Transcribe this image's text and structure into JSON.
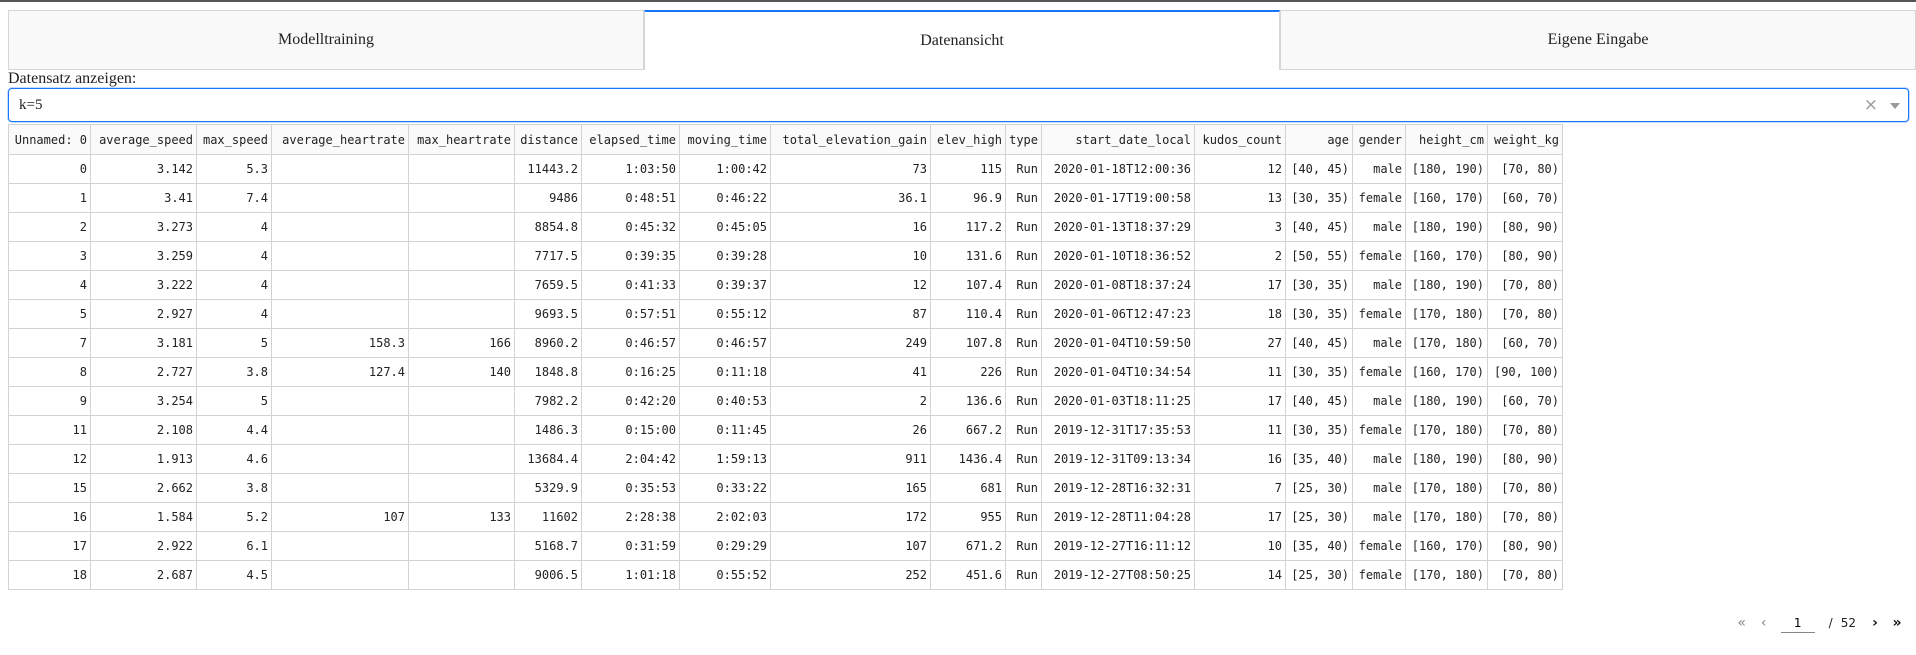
{
  "tabs": [
    "Modelltraining",
    "Datenansicht",
    "Eigene Eingabe"
  ],
  "dataset": {
    "label": "Datensatz anzeigen:",
    "value": "k=5",
    "clear_glyph": "×"
  },
  "columns": [
    "Unnamed: 0",
    "average_speed",
    "max_speed",
    "average_heartrate",
    "max_heartrate",
    "distance",
    "elapsed_time",
    "moving_time",
    "total_elevation_gain",
    "elev_high",
    "type",
    "start_date_local",
    "kudos_count",
    "age",
    "gender",
    "height_cm",
    "weight_kg"
  ],
  "rows": [
    [
      "0",
      "3.142",
      "5.3",
      "",
      "",
      "11443.2",
      "1:03:50",
      "1:00:42",
      "73",
      "115",
      "Run",
      "2020-01-18T12:00:36",
      "12",
      "[40, 45)",
      "male",
      "[180, 190)",
      "[70, 80)"
    ],
    [
      "1",
      "3.41",
      "7.4",
      "",
      "",
      "9486",
      "0:48:51",
      "0:46:22",
      "36.1",
      "96.9",
      "Run",
      "2020-01-17T19:00:58",
      "13",
      "[30, 35)",
      "female",
      "[160, 170)",
      "[60, 70)"
    ],
    [
      "2",
      "3.273",
      "4",
      "",
      "",
      "8854.8",
      "0:45:32",
      "0:45:05",
      "16",
      "117.2",
      "Run",
      "2020-01-13T18:37:29",
      "3",
      "[40, 45)",
      "male",
      "[180, 190)",
      "[80, 90)"
    ],
    [
      "3",
      "3.259",
      "4",
      "",
      "",
      "7717.5",
      "0:39:35",
      "0:39:28",
      "10",
      "131.6",
      "Run",
      "2020-01-10T18:36:52",
      "2",
      "[50, 55)",
      "female",
      "[160, 170)",
      "[80, 90)"
    ],
    [
      "4",
      "3.222",
      "4",
      "",
      "",
      "7659.5",
      "0:41:33",
      "0:39:37",
      "12",
      "107.4",
      "Run",
      "2020-01-08T18:37:24",
      "17",
      "[30, 35)",
      "male",
      "[180, 190)",
      "[70, 80)"
    ],
    [
      "5",
      "2.927",
      "4",
      "",
      "",
      "9693.5",
      "0:57:51",
      "0:55:12",
      "87",
      "110.4",
      "Run",
      "2020-01-06T12:47:23",
      "18",
      "[30, 35)",
      "female",
      "[170, 180)",
      "[70, 80)"
    ],
    [
      "7",
      "3.181",
      "5",
      "158.3",
      "166",
      "8960.2",
      "0:46:57",
      "0:46:57",
      "249",
      "107.8",
      "Run",
      "2020-01-04T10:59:50",
      "27",
      "[40, 45)",
      "male",
      "[170, 180)",
      "[60, 70)"
    ],
    [
      "8",
      "2.727",
      "3.8",
      "127.4",
      "140",
      "1848.8",
      "0:16:25",
      "0:11:18",
      "41",
      "226",
      "Run",
      "2020-01-04T10:34:54",
      "11",
      "[30, 35)",
      "female",
      "[160, 170)",
      "[90, 100)"
    ],
    [
      "9",
      "3.254",
      "5",
      "",
      "",
      "7982.2",
      "0:42:20",
      "0:40:53",
      "2",
      "136.6",
      "Run",
      "2020-01-03T18:11:25",
      "17",
      "[40, 45)",
      "male",
      "[180, 190)",
      "[60, 70)"
    ],
    [
      "11",
      "2.108",
      "4.4",
      "",
      "",
      "1486.3",
      "0:15:00",
      "0:11:45",
      "26",
      "667.2",
      "Run",
      "2019-12-31T17:35:53",
      "11",
      "[30, 35)",
      "female",
      "[170, 180)",
      "[70, 80)"
    ],
    [
      "12",
      "1.913",
      "4.6",
      "",
      "",
      "13684.4",
      "2:04:42",
      "1:59:13",
      "911",
      "1436.4",
      "Run",
      "2019-12-31T09:13:34",
      "16",
      "[35, 40)",
      "male",
      "[180, 190)",
      "[80, 90)"
    ],
    [
      "15",
      "2.662",
      "3.8",
      "",
      "",
      "5329.9",
      "0:35:53",
      "0:33:22",
      "165",
      "681",
      "Run",
      "2019-12-28T16:32:31",
      "7",
      "[25, 30)",
      "male",
      "[170, 180)",
      "[70, 80)"
    ],
    [
      "16",
      "1.584",
      "5.2",
      "107",
      "133",
      "11602",
      "2:28:38",
      "2:02:03",
      "172",
      "955",
      "Run",
      "2019-12-28T11:04:28",
      "17",
      "[25, 30)",
      "male",
      "[170, 180)",
      "[70, 80)"
    ],
    [
      "17",
      "2.922",
      "6.1",
      "",
      "",
      "5168.7",
      "0:31:59",
      "0:29:29",
      "107",
      "671.2",
      "Run",
      "2019-12-27T16:11:12",
      "10",
      "[35, 40)",
      "female",
      "[160, 170)",
      "[80, 90)"
    ],
    [
      "18",
      "2.687",
      "4.5",
      "",
      "",
      "9006.5",
      "1:01:18",
      "0:55:52",
      "252",
      "451.6",
      "Run",
      "2019-12-27T08:50:25",
      "14",
      "[25, 30)",
      "female",
      "[170, 180)",
      "[70, 80)"
    ]
  ],
  "pagination": {
    "first_glyph": "«",
    "prev_glyph": "‹",
    "current": "1",
    "separator": "/",
    "total": "52",
    "next_glyph": "›",
    "last_glyph": "»"
  }
}
